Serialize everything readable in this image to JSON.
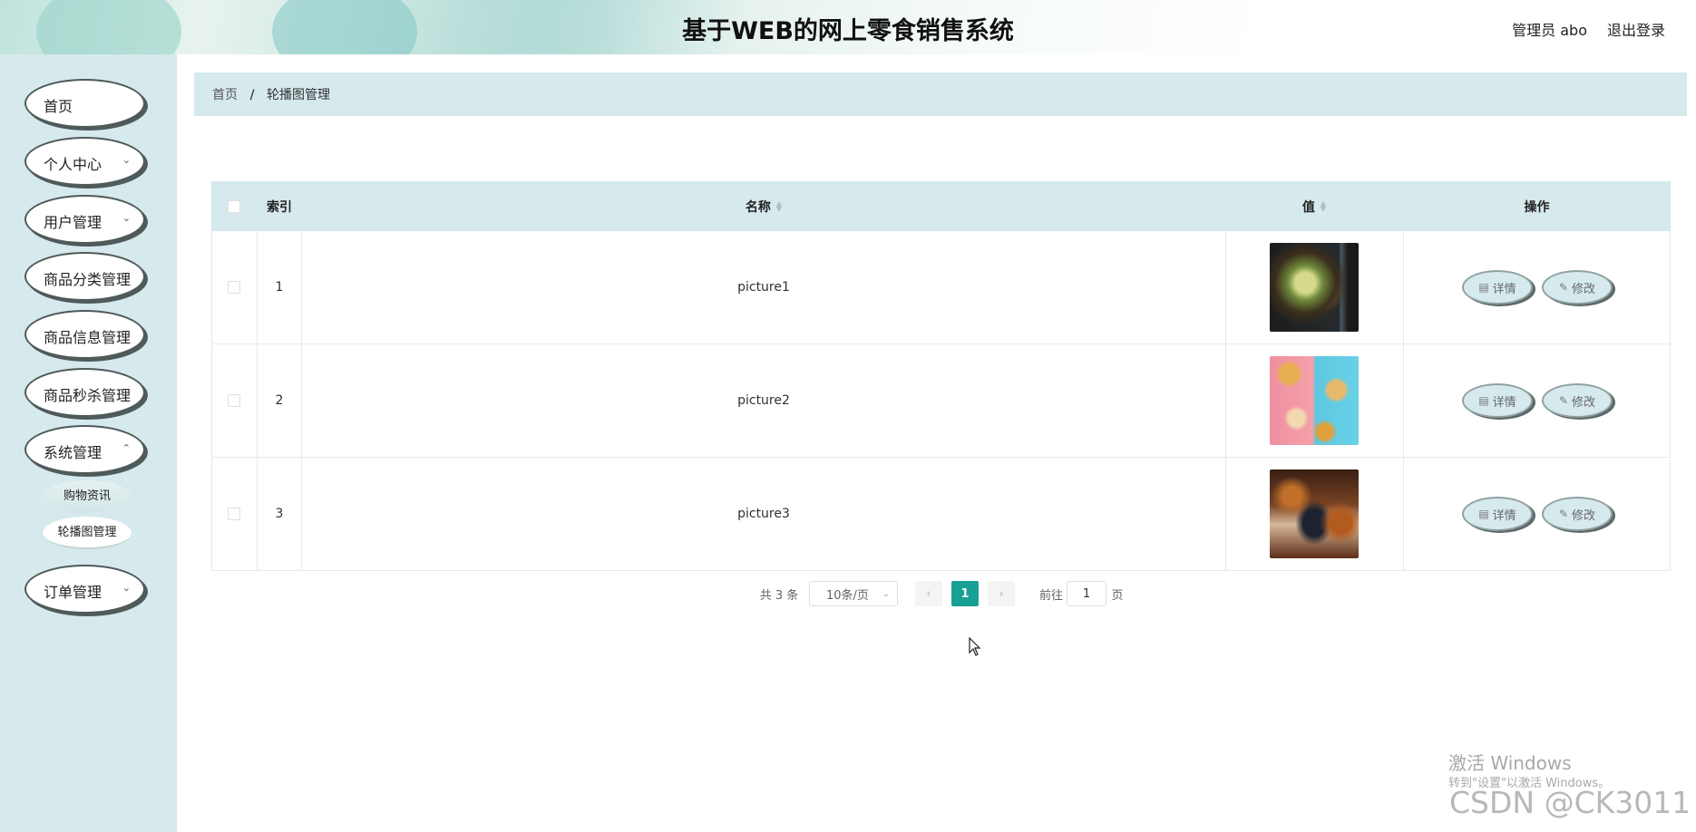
{
  "header": {
    "title": "基于WEB的网上零食销售系统",
    "user": "管理员 abo",
    "logout": "退出登录"
  },
  "sidebar": {
    "items": [
      {
        "label": "首页",
        "has_submenu": false
      },
      {
        "label": "个人中心",
        "has_submenu": true
      },
      {
        "label": "用户管理",
        "has_submenu": true
      },
      {
        "label": "商品分类管理",
        "has_submenu": false
      },
      {
        "label": "商品信息管理",
        "has_submenu": false
      },
      {
        "label": "商品秒杀管理",
        "has_submenu": false
      },
      {
        "label": "系统管理",
        "has_submenu": true,
        "expanded": true
      },
      {
        "label": "订单管理",
        "has_submenu": true
      }
    ],
    "system_subitems": [
      {
        "label": "购物资讯",
        "active": false
      },
      {
        "label": "轮播图管理",
        "active": true
      }
    ]
  },
  "breadcrumb": {
    "home": "首页",
    "sep": "/",
    "current": "轮播图管理"
  },
  "table": {
    "columns": {
      "index": "索引",
      "name": "名称",
      "value": "值",
      "actions": "操作"
    },
    "rows": [
      {
        "index": "1",
        "name": "picture1",
        "thumb": "salad-bowl"
      },
      {
        "index": "2",
        "name": "picture2",
        "thumb": "japanese-snacks"
      },
      {
        "index": "3",
        "name": "picture3",
        "thumb": "drinks-blur"
      }
    ],
    "detail_label": "详情",
    "edit_label": "修改"
  },
  "pagination": {
    "total": "共 3 条",
    "page_size": "10条/页",
    "current_page": "1",
    "goto_prefix": "前往",
    "goto_value": "1",
    "goto_suffix": "页"
  },
  "watermark": {
    "activate_title": "激活 Windows",
    "activate_hint": "转到\"设置\"以激活 Windows。",
    "csdn": "CSDN @CK3011"
  },
  "colors": {
    "accent": "#18a094",
    "panel": "#d6e9ec"
  }
}
